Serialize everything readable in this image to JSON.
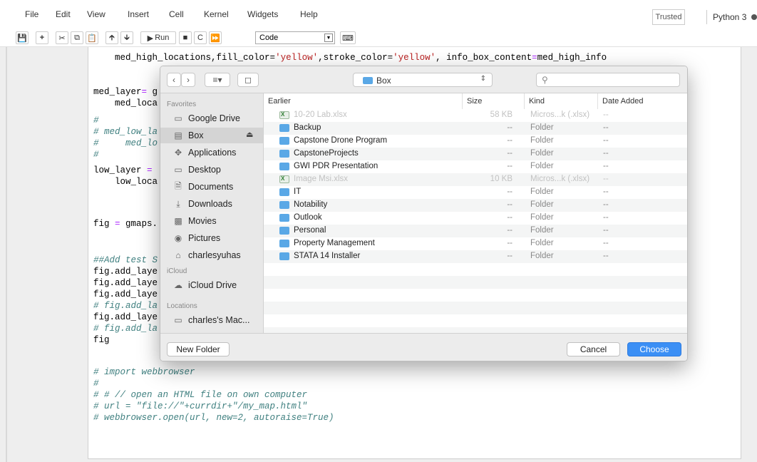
{
  "menu": {
    "items": [
      "File",
      "Edit",
      "View",
      "Insert",
      "Cell",
      "Kernel",
      "Widgets",
      "Help"
    ],
    "trusted": "Trusted",
    "kernel": "Python 3"
  },
  "toolbar": {
    "run_label": "Run",
    "cell_type": "Code",
    "icons": [
      "save-icon",
      "add-cell-icon",
      "cut-icon",
      "copy-icon",
      "paste-icon",
      "move-up-icon",
      "move-down-icon",
      "run-icon",
      "stop-icon",
      "restart-icon",
      "fast-forward-icon",
      "keyboard-icon"
    ]
  },
  "code": {
    "line1": {
      "a": "med_high_locations,fill_color=",
      "b": "'yellow'",
      "c": ",stroke_color=",
      "d": "'yellow'",
      "e": ", info_box_content",
      "f": "=",
      "g": "med_high_info"
    },
    "line2": {
      "a": "med_layer",
      "b": "=",
      "c": " g"
    },
    "line3": "    med_loca",
    "line4": "#",
    "line5": "# med_low_la",
    "line6": "#     med_lo",
    "line7": "#",
    "line8": {
      "a": "low_layer ",
      "b": "=",
      "c": " "
    },
    "line9": "    low_loca",
    "line10": {
      "a": "fig ",
      "b": "=",
      "c": " gmaps."
    },
    "line11": "##Add test S",
    "line12": "fig.add_laye",
    "line13": "fig.add_laye",
    "line14": "fig.add_laye",
    "line15": "# fig.add_la",
    "line16": "fig.add_laye",
    "line17": "# fig.add_la",
    "line18": "fig",
    "line19": "# import webbrowser",
    "line20": "#",
    "line21": "# # // open an HTML file on own computer",
    "line22": "# url = \"file://\"+currdir+\"/my_map.html\"",
    "line23": "# webbrowser.open(url, new=2, autoraise=True)"
  },
  "dialog": {
    "location": "Box",
    "search_placeholder": "",
    "sidebar": {
      "favorites_header": "Favorites",
      "favorites": [
        {
          "label": "Google Drive",
          "icon": "folder-icon"
        },
        {
          "label": "Box",
          "icon": "drive-icon",
          "selected": true
        },
        {
          "label": "Applications",
          "icon": "applications-icon"
        },
        {
          "label": "Desktop",
          "icon": "desktop-icon"
        },
        {
          "label": "Documents",
          "icon": "documents-icon"
        },
        {
          "label": "Downloads",
          "icon": "downloads-icon"
        },
        {
          "label": "Movies",
          "icon": "movies-icon"
        },
        {
          "label": "Pictures",
          "icon": "pictures-icon"
        },
        {
          "label": "charlesyuhas",
          "icon": "home-icon"
        }
      ],
      "icloud_header": "iCloud",
      "icloud": [
        {
          "label": "iCloud Drive",
          "icon": "cloud-icon"
        }
      ],
      "locations_header": "Locations",
      "locations": [
        {
          "label": "charles's Mac...",
          "icon": "computer-icon"
        }
      ]
    },
    "columns": {
      "name": "Earlier",
      "size": "Size",
      "kind": "Kind",
      "date": "Date Added"
    },
    "files": [
      {
        "name": "10-20 Lab.xlsx",
        "size": "58 KB",
        "kind": "Micros...k (.xlsx)",
        "date": "--",
        "type": "xlsx",
        "dim": true
      },
      {
        "name": "Backup",
        "size": "--",
        "kind": "Folder",
        "date": "--",
        "type": "folder"
      },
      {
        "name": "Capstone Drone Program",
        "size": "--",
        "kind": "Folder",
        "date": "--",
        "type": "folder"
      },
      {
        "name": "CapstoneProjects",
        "size": "--",
        "kind": "Folder",
        "date": "--",
        "type": "folder"
      },
      {
        "name": "GWI PDR Presentation",
        "size": "--",
        "kind": "Folder",
        "date": "--",
        "type": "folder"
      },
      {
        "name": "Image Msi.xlsx",
        "size": "10 KB",
        "kind": "Micros...k (.xlsx)",
        "date": "--",
        "type": "xlsx",
        "dim": true
      },
      {
        "name": "IT",
        "size": "--",
        "kind": "Folder",
        "date": "--",
        "type": "folder"
      },
      {
        "name": "Notability",
        "size": "--",
        "kind": "Folder",
        "date": "--",
        "type": "folder"
      },
      {
        "name": "Outlook",
        "size": "--",
        "kind": "Folder",
        "date": "--",
        "type": "folder"
      },
      {
        "name": "Personal",
        "size": "--",
        "kind": "Folder",
        "date": "--",
        "type": "folder"
      },
      {
        "name": "Property Management",
        "size": "--",
        "kind": "Folder",
        "date": "--",
        "type": "folder"
      },
      {
        "name": "STATA 14 Installer",
        "size": "--",
        "kind": "Folder",
        "date": "--",
        "type": "folder"
      }
    ],
    "new_folder_label": "New Folder",
    "cancel_label": "Cancel",
    "choose_label": "Choose"
  }
}
